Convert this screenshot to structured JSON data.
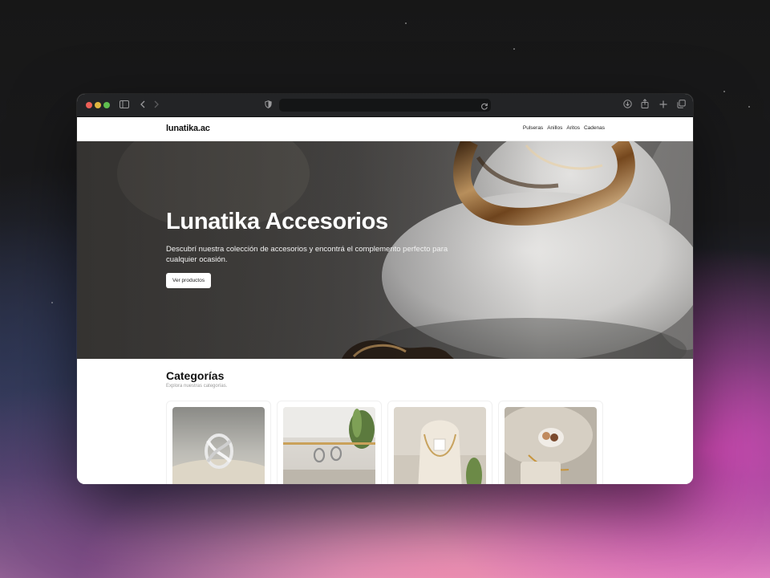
{
  "browser": {
    "url": ""
  },
  "site": {
    "logo": "lunatika.ac",
    "nav": [
      "Pulseras",
      "Anillos",
      "Aritos",
      "Cadenas"
    ]
  },
  "hero": {
    "title": "Lunatika Accesorios",
    "description": "Descubrí nuestra colección de accesorios y encontrá el complemento perfecto para cualquier ocasión.",
    "button_label": "Ver productos"
  },
  "categories": {
    "title": "Categorías",
    "subtitle": "Explora nuestras categorías.",
    "items": [
      {
        "image": "ring-photo"
      },
      {
        "image": "earrings-photo"
      },
      {
        "image": "necklace-photo"
      },
      {
        "image": "bracelet-photo"
      }
    ]
  },
  "colors": {
    "page_background": "#ffffff",
    "text_primary": "#111111",
    "button_background": "#ffffff",
    "browser_chrome": "#232426"
  }
}
